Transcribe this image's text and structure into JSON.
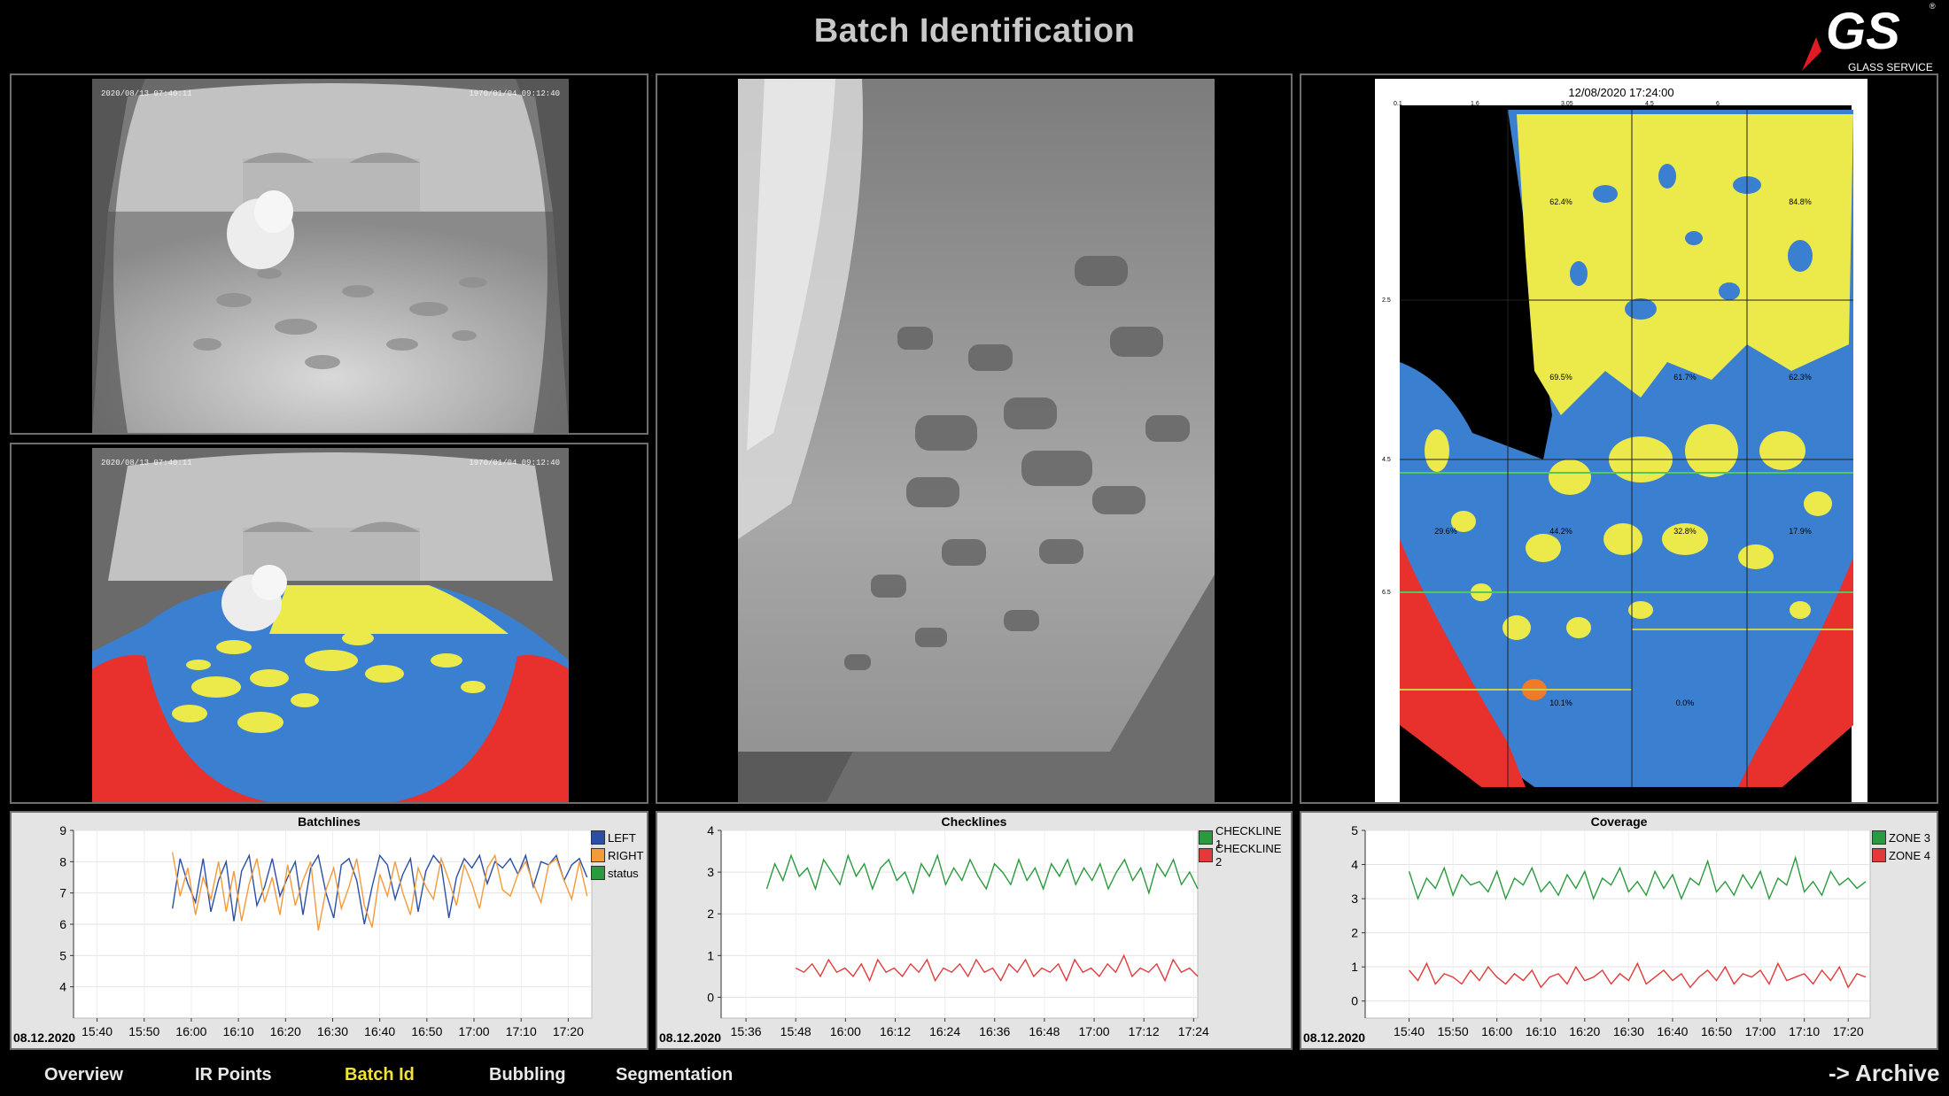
{
  "page": {
    "title": "Batch Identification"
  },
  "logo": {
    "text": "GS",
    "sub": "GLASS SERVICE",
    "mark": "®",
    "colors": {
      "red": "#e01b24",
      "white": "#ffffff"
    }
  },
  "cameras": {
    "top_left": {
      "left_ts": "2020/08/13 07:40:11",
      "right_ts": "1970/01/04 09:12:40"
    },
    "bottom_left": {
      "left_ts": "2020/08/13 07:40:11",
      "right_ts": "1970/01/04 09:12:40"
    }
  },
  "segmentation": {
    "timestamp": "12/08/2020 17:24:00",
    "top_scale": [
      "0.1",
      "1.6",
      "3.05",
      "4.5",
      "6"
    ],
    "left_scale": [
      "2.5",
      "4.5",
      "6.5"
    ],
    "zone_pcts": [
      "62.4%",
      "84.8%",
      "69.5%",
      "61.7%",
      "62.3%",
      "29.6%",
      "44.2%",
      "32.8%",
      "17.9%",
      "10.1%",
      "0.0%"
    ],
    "colors": {
      "batch": "#ecea4a",
      "glass": "#3b7fd0",
      "mask": "#e8302c",
      "foam": "#ef7a2a",
      "background": "#000000"
    }
  },
  "charts": [
    {
      "id": "batchlines",
      "title": "Batchlines",
      "date": "08.12.2020",
      "x_ticks": [
        "15:40",
        "15:50",
        "16:00",
        "16:10",
        "16:20",
        "16:30",
        "16:40",
        "16:50",
        "17:00",
        "17:10",
        "17:20"
      ],
      "y_ticks": [
        "4",
        "5",
        "6",
        "7",
        "8",
        "9"
      ],
      "legend": [
        {
          "name": "LEFT",
          "color": "#2b4fa6"
        },
        {
          "name": "RIGHT",
          "color": "#f39a3a"
        },
        {
          "name": "status",
          "color": "#2a9a3e"
        }
      ]
    },
    {
      "id": "checklines",
      "title": "Checklines",
      "date": "08.12.2020",
      "x_ticks": [
        "15:36",
        "15:48",
        "16:00",
        "16:12",
        "16:24",
        "16:36",
        "16:48",
        "17:00",
        "17:12",
        "17:24"
      ],
      "y_ticks": [
        "0",
        "1",
        "2",
        "3",
        "4"
      ],
      "legend": [
        {
          "name": "CHECKLINE 1",
          "color": "#2a9a3e"
        },
        {
          "name": "CHECKLINE 2",
          "color": "#e23a3a"
        }
      ]
    },
    {
      "id": "coverage",
      "title": "Coverage",
      "date": "08.12.2020",
      "x_ticks": [
        "15:40",
        "15:50",
        "16:00",
        "16:10",
        "16:20",
        "16:30",
        "16:40",
        "16:50",
        "17:00",
        "17:10",
        "17:20"
      ],
      "y_ticks": [
        "0",
        "1",
        "2",
        "3",
        "4",
        "5"
      ],
      "legend": [
        {
          "name": "ZONE 3",
          "color": "#2a9a3e"
        },
        {
          "name": "ZONE 4",
          "color": "#e23a3a"
        }
      ]
    }
  ],
  "chart_data": [
    {
      "type": "line",
      "title": "Batchlines",
      "xlabel": "",
      "ylabel": "",
      "x_range": [
        "15:35",
        "17:25"
      ],
      "ylim": [
        3,
        9
      ],
      "grid": true,
      "legend_position": "right",
      "series": [
        {
          "name": "LEFT",
          "x_range": [
            "15:56",
            "17:24"
          ],
          "values": [
            6.5,
            8.1,
            7.3,
            6.7,
            8.1,
            6.4,
            7.4,
            8.0,
            6.1,
            7.7,
            8.2,
            6.6,
            7.2,
            8.1,
            6.9,
            7.5,
            8.0,
            6.3,
            7.8,
            8.2,
            7.0,
            6.2,
            7.9,
            8.1,
            7.4,
            6.0,
            7.2,
            8.2,
            7.9,
            6.8,
            7.6,
            8.1,
            6.4,
            7.7,
            8.2,
            7.9,
            6.2,
            7.5,
            8.1,
            7.8,
            8.2,
            7.3,
            8.0,
            7.8,
            8.1,
            7.6,
            8.2,
            7.2,
            8.0,
            7.9,
            8.2,
            7.4,
            7.9,
            8.1,
            7.5
          ]
        },
        {
          "name": "RIGHT",
          "x_range": [
            "15:56",
            "17:24"
          ],
          "values": [
            8.3,
            6.9,
            7.8,
            6.3,
            7.5,
            6.8,
            8.0,
            6.4,
            7.7,
            6.1,
            7.3,
            8.1,
            6.7,
            7.5,
            6.3,
            7.9,
            6.6,
            7.4,
            8.0,
            5.8,
            7.1,
            7.8,
            6.5,
            7.2,
            8.1,
            6.6,
            5.9,
            7.6,
            6.9,
            8.0,
            7.0,
            6.3,
            7.8,
            7.2,
            6.8,
            8.1,
            7.4,
            6.6,
            7.9,
            7.3,
            6.5,
            7.8,
            8.2,
            7.1,
            6.9,
            7.6,
            8.0,
            7.3,
            6.7,
            7.9,
            8.1,
            7.4,
            6.8,
            8.0,
            6.9
          ]
        },
        {
          "name": "status",
          "values": []
        }
      ]
    },
    {
      "type": "line",
      "title": "Checklines",
      "xlabel": "",
      "ylabel": "",
      "x_range": [
        "15:30",
        "17:25"
      ],
      "ylim": [
        -0.5,
        4
      ],
      "grid": true,
      "legend_position": "right",
      "series": [
        {
          "name": "CHECKLINE 1",
          "x_range": [
            "15:41",
            "17:25"
          ],
          "values": [
            2.6,
            3.2,
            2.8,
            3.4,
            2.9,
            3.1,
            2.6,
            3.3,
            3.0,
            2.7,
            3.4,
            2.9,
            3.2,
            2.6,
            3.1,
            3.3,
            2.8,
            3.0,
            2.5,
            3.2,
            2.9,
            3.4,
            2.7,
            3.1,
            2.8,
            3.3,
            2.9,
            2.6,
            3.2,
            3.0,
            2.7,
            3.3,
            2.8,
            3.1,
            2.6,
            3.2,
            2.9,
            3.3,
            2.7,
            3.1,
            2.8,
            3.2,
            2.6,
            3.0,
            3.3,
            2.8,
            3.1,
            2.5,
            3.2,
            2.9,
            3.3,
            2.7,
            3.0,
            2.6
          ]
        },
        {
          "name": "CHECKLINE 2",
          "x_range": [
            "15:48",
            "17:25"
          ],
          "values": [
            0.7,
            0.6,
            0.8,
            0.5,
            0.9,
            0.6,
            0.7,
            0.5,
            0.8,
            0.4,
            0.9,
            0.6,
            0.7,
            0.5,
            0.8,
            0.6,
            0.9,
            0.4,
            0.7,
            0.6,
            0.8,
            0.5,
            0.9,
            0.6,
            0.7,
            0.4,
            0.8,
            0.6,
            0.9,
            0.5,
            0.7,
            0.6,
            0.8,
            0.4,
            0.9,
            0.6,
            0.7,
            0.5,
            0.8,
            0.6,
            1.0,
            0.5,
            0.7,
            0.6,
            0.8,
            0.4,
            0.9,
            0.6,
            0.7,
            0.5
          ]
        }
      ]
    },
    {
      "type": "line",
      "title": "Coverage",
      "xlabel": "",
      "ylabel": "",
      "x_range": [
        "15:30",
        "17:25"
      ],
      "ylim": [
        -0.5,
        5
      ],
      "grid": true,
      "legend_position": "right",
      "series": [
        {
          "name": "ZONE 3",
          "x_range": [
            "15:40",
            "17:24"
          ],
          "values": [
            3.8,
            3.0,
            3.6,
            3.3,
            3.9,
            3.1,
            3.7,
            3.4,
            3.5,
            3.2,
            3.8,
            3.0,
            3.6,
            3.4,
            3.9,
            3.2,
            3.5,
            3.1,
            3.7,
            3.3,
            3.8,
            3.0,
            3.6,
            3.4,
            3.9,
            3.2,
            3.5,
            3.1,
            3.8,
            3.3,
            3.7,
            3.0,
            3.6,
            3.4,
            4.1,
            3.2,
            3.5,
            3.1,
            3.7,
            3.3,
            3.8,
            3.0,
            3.6,
            3.4,
            4.2,
            3.2,
            3.5,
            3.1,
            3.8,
            3.4,
            3.6,
            3.3,
            3.5
          ]
        },
        {
          "name": "ZONE 4",
          "x_range": [
            "15:40",
            "17:24"
          ],
          "values": [
            0.9,
            0.6,
            1.1,
            0.5,
            0.8,
            0.7,
            0.5,
            0.9,
            0.6,
            1.0,
            0.7,
            0.5,
            0.8,
            0.6,
            0.9,
            0.4,
            0.7,
            0.8,
            0.5,
            1.0,
            0.6,
            0.7,
            0.9,
            0.5,
            0.8,
            0.6,
            1.1,
            0.5,
            0.7,
            0.9,
            0.6,
            0.8,
            0.4,
            0.7,
            0.9,
            0.6,
            1.0,
            0.5,
            0.8,
            0.7,
            0.9,
            0.5,
            1.1,
            0.6,
            0.7,
            0.8,
            0.5,
            0.9,
            0.6,
            1.0,
            0.4,
            0.8,
            0.7
          ]
        }
      ]
    }
  ],
  "nav": {
    "items": [
      {
        "label": "Overview",
        "active": false
      },
      {
        "label": "IR Points",
        "active": false
      },
      {
        "label": "Batch Id",
        "active": true
      },
      {
        "label": "Bubbling",
        "active": false
      },
      {
        "label": "Segmentation",
        "active": false
      }
    ],
    "archive": "-> Archive"
  }
}
